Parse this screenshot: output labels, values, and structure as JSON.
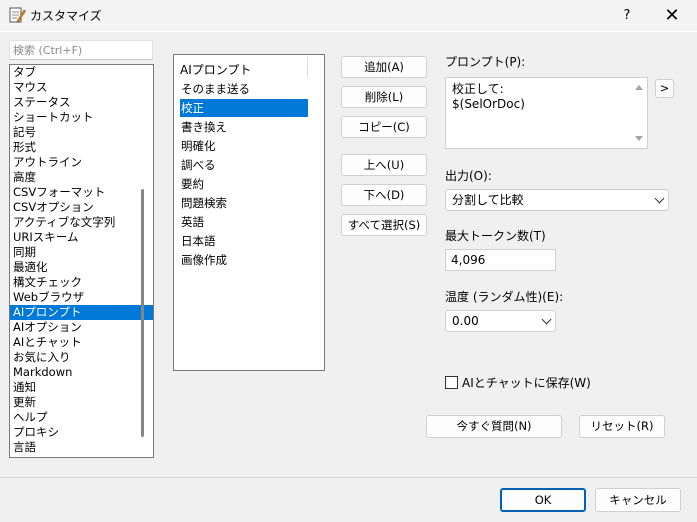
{
  "window": {
    "title": "カスタマイズ",
    "help": "?",
    "close": "✕"
  },
  "search": {
    "placeholder": "検索 (Ctrl+F)"
  },
  "categories": [
    "タブ",
    "マウス",
    "ステータス",
    "ショートカット",
    "記号",
    "形式",
    "アウトライン",
    "高度",
    "CSVフォーマット",
    "CSVオプション",
    "アクティブな文字列",
    "URIスキーム",
    "同期",
    "最適化",
    "構文チェック",
    "Webブラウザ",
    "AIプロンプト",
    "AIオプション",
    "AIとチャット",
    "お気に入り",
    "Markdown",
    "通知",
    "更新",
    "ヘルプ",
    "プロキシ",
    "言語"
  ],
  "selected_category": "AIプロンプト",
  "prompt_list": {
    "header": "AIプロンプト",
    "items": [
      "そのまま送る",
      "校正",
      "書き換え",
      "明確化",
      "調べる",
      "要約",
      "問題検索",
      "英語",
      "日本語",
      "画像作成"
    ],
    "selected": "校正"
  },
  "buttons": {
    "add": "追加(A)",
    "delete": "削除(L)",
    "copy": "コピー(C)",
    "up": "上へ(U)",
    "down": "下へ(D)",
    "select_all": "すべて選択(S)",
    "expand": ">",
    "ask_now": "今すぐ質問(N)",
    "reset": "リセット(R)",
    "ok": "OK",
    "cancel": "キャンセル"
  },
  "prompt": {
    "label": "プロンプト(P):",
    "value": "校正して:\n$(SelOrDoc)"
  },
  "output": {
    "label": "出力(O):",
    "value": "分割して比較"
  },
  "max_tokens": {
    "label": "最大トークン数(T)",
    "value": "4,096"
  },
  "temperature": {
    "label": "温度 (ランダム性)(E):",
    "value": "0.00"
  },
  "save_to_chat": {
    "label": "AIとチャットに保存(W)",
    "checked": false
  },
  "colors": {
    "selection": "#0078d7",
    "primary_border": "#005fb8"
  }
}
